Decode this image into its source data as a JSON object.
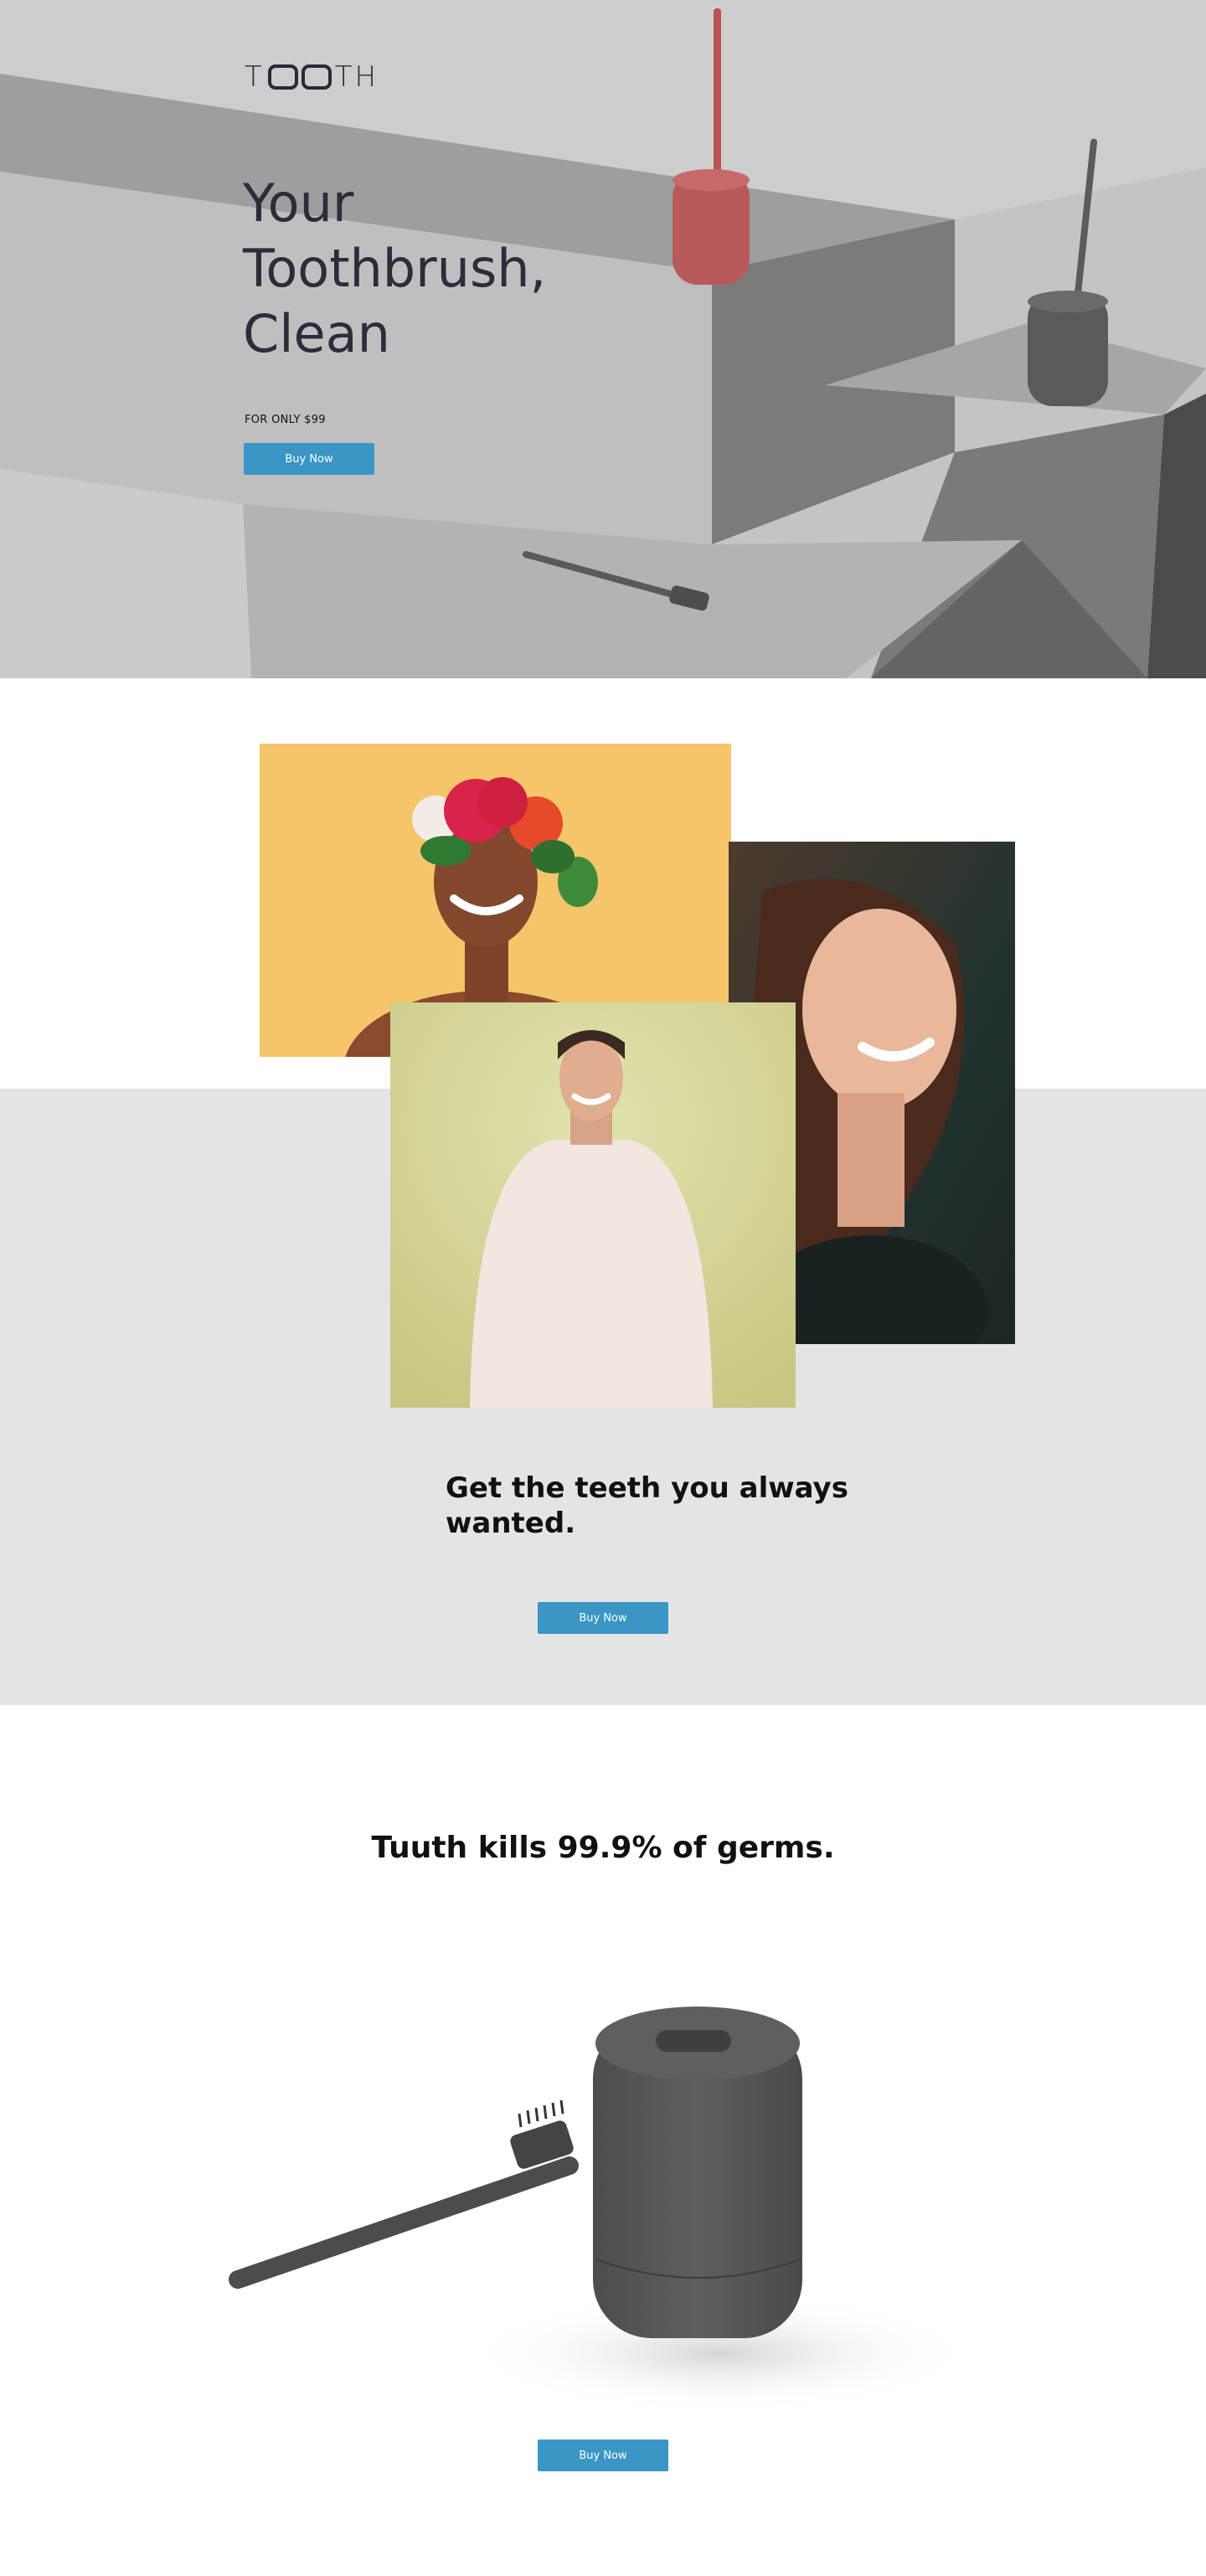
{
  "hero": {
    "logo": {
      "left": "T",
      "right": "TH"
    },
    "title": "Your Toothbrush, Clean",
    "price": "FOR ONLY $99",
    "cta_label": "Buy Now"
  },
  "people": {
    "tagline": "Get the teeth you always wanted.",
    "cta_label": "Buy Now"
  },
  "germs": {
    "title": "Tuuth kills 99.9% of germs.",
    "cta_label": "Buy Now"
  },
  "colors": {
    "accent": "#3a96c4",
    "hero_bg": "#bdbdbd",
    "people_band": "#e4e4e4",
    "holder_red": "#b85656",
    "holder_gray": "#555555"
  }
}
